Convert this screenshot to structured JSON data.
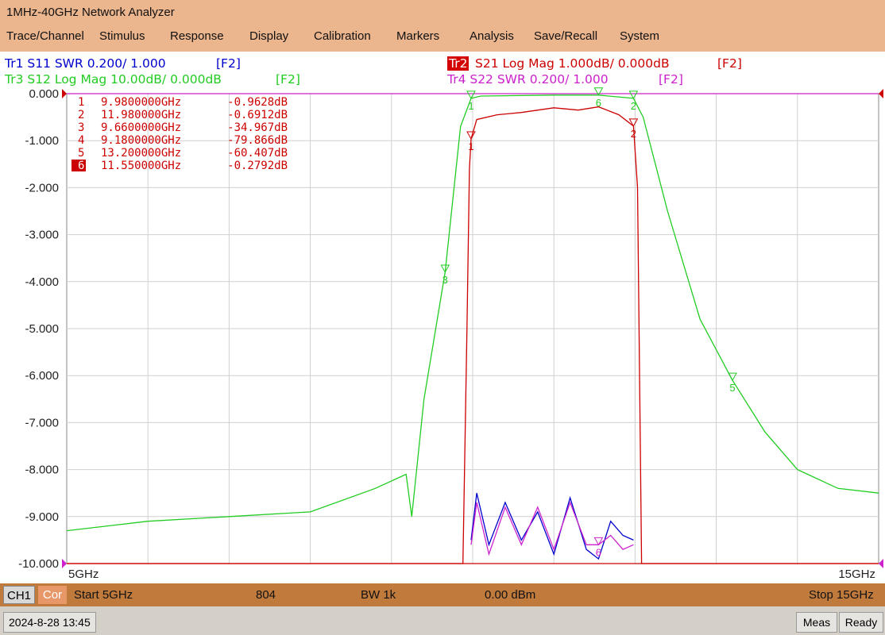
{
  "window": {
    "title": "1MHz-40GHz Network Analyzer"
  },
  "menu": [
    "Trace/Channel",
    "Stimulus",
    "Response",
    "Display",
    "Calibration",
    "Markers",
    "Analysis",
    "Save/Recall",
    "System"
  ],
  "traces": {
    "tr1": {
      "text": "Tr1 S11 SWR 0.200/ 1.000",
      "fkey": "[F2]",
      "color": "#0000cc"
    },
    "tr2": {
      "tag": "Tr2",
      "text": "S21 Log Mag 1.000dB/ 0.000dB",
      "fkey": "[F2]",
      "color": "#cc0000"
    },
    "tr3": {
      "text": "Tr3 S12 Log Mag 10.00dB/ 0.000dB",
      "fkey": "[F2]",
      "color": "#22cc22"
    },
    "tr4": {
      "text": "Tr4 S22 SWR 0.200/ 1.000",
      "fkey": "[F2]",
      "color": "#cc22cc"
    }
  },
  "markers_table": [
    {
      "num": "1",
      "freq": "9.9800000GHz",
      "value": "-0.9628dB"
    },
    {
      "num": "2",
      "freq": "11.980000GHz",
      "value": "-0.6912dB"
    },
    {
      "num": "3",
      "freq": "9.6600000GHz",
      "value": "-34.967dB"
    },
    {
      "num": "4",
      "freq": "9.1800000GHz",
      "value": "-79.866dB"
    },
    {
      "num": "5",
      "freq": "13.200000GHz",
      "value": "-60.407dB"
    },
    {
      "num": "6",
      "freq": "11.550000GHz",
      "value": "-0.2792dB",
      "active": true
    }
  ],
  "axis": {
    "y_ticks": [
      "0.000",
      "-1.000",
      "-2.000",
      "-3.000",
      "-4.000",
      "-5.000",
      "-6.000",
      "-7.000",
      "-8.000",
      "-9.000",
      "-10.000"
    ],
    "x_start": "5GHz",
    "x_stop": "15GHz"
  },
  "status": {
    "channel": "CH1",
    "cor": "Cor",
    "start": "Start 5GHz",
    "points": "804",
    "bw": "BW 1k",
    "power": "0.00 dBm",
    "stop": "Stop 15GHz"
  },
  "footer": {
    "datetime": "2024-8-28 13:45",
    "meas": "Meas",
    "ready": "Ready"
  },
  "chart_data": {
    "type": "line",
    "xlim": [
      5,
      15
    ],
    "ylim": [
      -10,
      0
    ],
    "grid": true,
    "series": [
      {
        "name": "Tr2 S21 Log Mag",
        "color": "#cc0000",
        "x": [
          5,
          9.88,
          9.93,
          9.96,
          9.98,
          10.05,
          10.3,
          10.6,
          11.0,
          11.3,
          11.55,
          11.8,
          11.98,
          12.03,
          12.08,
          15
        ],
        "y": [
          -10,
          -10,
          -5.0,
          -1.6,
          -0.96,
          -0.55,
          -0.45,
          -0.4,
          -0.3,
          -0.35,
          -0.28,
          -0.45,
          -0.69,
          -2.0,
          -10,
          -10
        ]
      },
      {
        "name": "Tr3 S12 Log Mag",
        "color": "#22cc22",
        "x": [
          5,
          6,
          7,
          8,
          8.8,
          9.18,
          9.25,
          9.4,
          9.66,
          9.85,
          9.98,
          10.1,
          11.0,
          11.55,
          11.98,
          12.1,
          12.4,
          12.8,
          13.2,
          13.6,
          14.0,
          14.5,
          15
        ],
        "y": [
          -9.3,
          -9.1,
          -9.0,
          -8.9,
          -8.4,
          -8.1,
          -9.0,
          -6.5,
          -3.8,
          -0.7,
          -0.1,
          -0.05,
          -0.03,
          -0.03,
          -0.1,
          -0.5,
          -2.5,
          -4.8,
          -6.1,
          -7.2,
          -8.0,
          -8.4,
          -8.5
        ]
      },
      {
        "name": "Tr1 S11 SWR",
        "color": "#0000cc",
        "x": [
          9.98,
          10.05,
          10.2,
          10.4,
          10.6,
          10.8,
          11.0,
          11.2,
          11.4,
          11.55,
          11.7,
          11.85,
          11.98
        ],
        "y": [
          -9.5,
          -8.5,
          -9.6,
          -8.7,
          -9.5,
          -8.9,
          -9.8,
          -8.6,
          -9.7,
          -9.9,
          -9.1,
          -9.4,
          -9.5
        ]
      },
      {
        "name": "Tr4 S22 SWR",
        "color": "#cc22cc",
        "x": [
          9.98,
          10.05,
          10.2,
          10.4,
          10.6,
          10.8,
          11.0,
          11.2,
          11.4,
          11.55,
          11.7,
          11.85,
          11.98
        ],
        "y": [
          -9.6,
          -8.7,
          -9.8,
          -8.8,
          -9.6,
          -8.8,
          -9.7,
          -8.7,
          -9.6,
          -9.6,
          -9.4,
          -9.7,
          -9.6
        ]
      }
    ],
    "markers": [
      {
        "label": "1",
        "x": 9.98,
        "y": -0.9628,
        "color": "#cc0000"
      },
      {
        "label": "2",
        "x": 11.98,
        "y": -0.6912,
        "color": "#cc0000"
      },
      {
        "label": "3",
        "x": 9.66,
        "y": -3.8,
        "color": "#22cc22"
      },
      {
        "label": "5",
        "x": 13.2,
        "y": -6.1,
        "color": "#22cc22"
      },
      {
        "label": "6",
        "x": 11.55,
        "y": -0.03,
        "color": "#22cc22"
      },
      {
        "label": "1",
        "x": 9.98,
        "y": -0.1,
        "color": "#22cc22"
      },
      {
        "label": "2",
        "x": 11.98,
        "y": -0.1,
        "color": "#22cc22"
      },
      {
        "label": "6",
        "x": 11.55,
        "y": -9.6,
        "color": "#cc22cc"
      }
    ]
  }
}
